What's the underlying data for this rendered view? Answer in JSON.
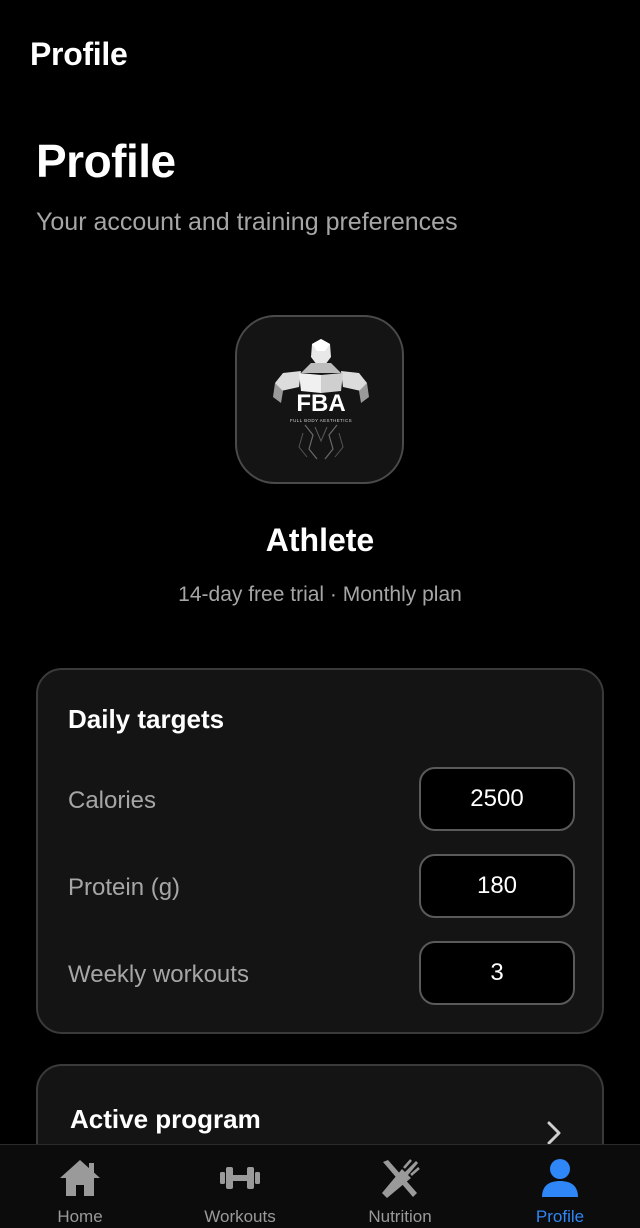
{
  "app_bar": {
    "title": "Profile"
  },
  "header": {
    "title": "Profile",
    "subtitle": "Your account and training preferences"
  },
  "profile": {
    "logo_icon": "fba-full-body-aesthetics-logo",
    "logo_text": "FBA",
    "logo_tagline": "FULL BODY AESTHETICS",
    "name": "Athlete",
    "plan": "14-day free trial · Monthly plan"
  },
  "daily_targets": {
    "title": "Daily targets",
    "rows": [
      {
        "label": "Calories",
        "value": "2500"
      },
      {
        "label": "Protein (g)",
        "value": "180"
      },
      {
        "label": "Weekly workouts",
        "value": "3"
      }
    ]
  },
  "active_program": {
    "title": "Active program",
    "icon": "chevron-right-icon"
  },
  "bottom_nav": {
    "active_color": "#2f86f6",
    "inactive_color": "#9a9a9a",
    "items": [
      {
        "label": "Home",
        "icon": "home-icon",
        "active": false
      },
      {
        "label": "Workouts",
        "icon": "dumbbell-icon",
        "active": false
      },
      {
        "label": "Nutrition",
        "icon": "fork-knife-icon",
        "active": false
      },
      {
        "label": "Profile",
        "icon": "person-icon",
        "active": true
      }
    ]
  }
}
